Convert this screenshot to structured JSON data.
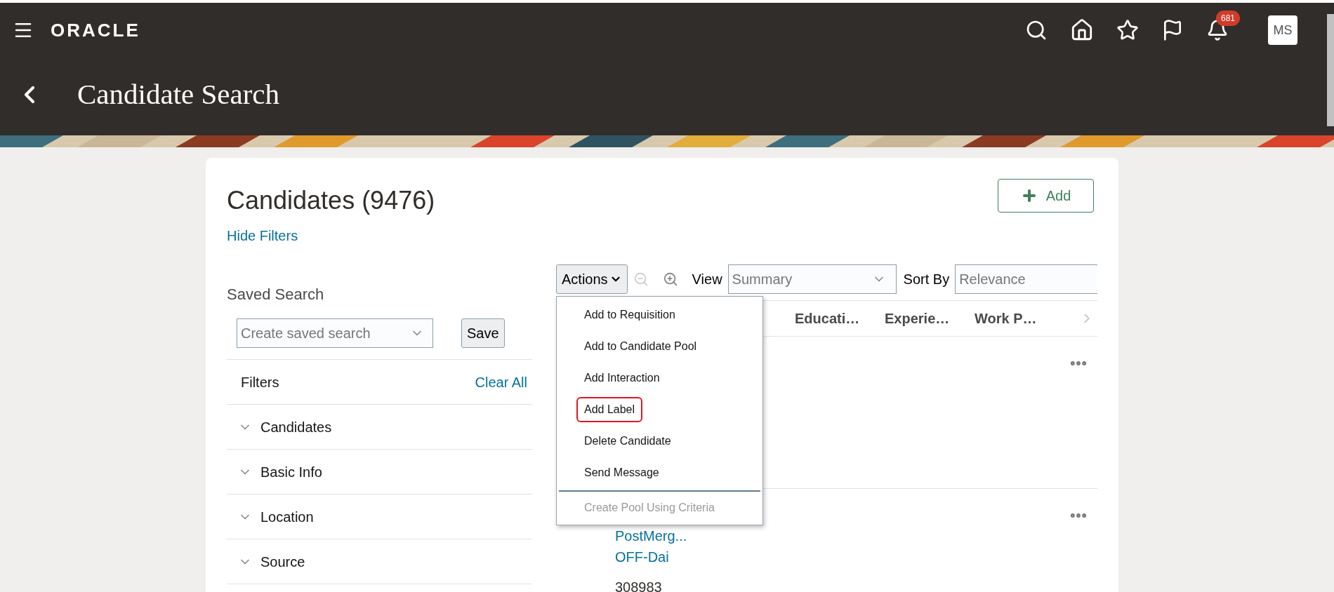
{
  "header": {
    "logo": "ORACLE",
    "notifications": {
      "count": "681"
    },
    "avatar": "MS"
  },
  "page": {
    "title": "Candidate Search"
  },
  "card": {
    "title": "Candidates (9476)",
    "add_button": "Add",
    "hide_filters": "Hide Filters",
    "saved_search": {
      "label": "Saved Search",
      "placeholder": "Create saved search",
      "save_button": "Save"
    },
    "filters": {
      "title": "Filters",
      "clear": "Clear All",
      "sections": [
        {
          "label": "Candidates",
          "expanded": false
        },
        {
          "label": "Basic Info",
          "expanded": false
        },
        {
          "label": "Location",
          "expanded": false
        },
        {
          "label": "Source",
          "expanded": false
        }
      ]
    },
    "toolbar": {
      "actions": "Actions",
      "view_label": "View",
      "view_value": "Summary",
      "sort_label": "Sort By",
      "sort_value": "Relevance"
    },
    "table": {
      "columns": [
        "Educati…",
        "Experie…",
        "Work P…"
      ],
      "rows": [
        {
          "lines": []
        },
        {
          "lines": [
            "PostMerg...",
            "OFF-Dai"
          ],
          "number": "308983"
        }
      ]
    },
    "actions_menu": {
      "items": [
        {
          "label": "Add to Requisition",
          "disabled": false,
          "highlighted": false
        },
        {
          "label": "Add to Candidate Pool",
          "disabled": false,
          "highlighted": false
        },
        {
          "label": "Add Interaction",
          "disabled": false,
          "highlighted": false
        },
        {
          "label": "Add Label",
          "disabled": false,
          "highlighted": true
        },
        {
          "label": "Delete Candidate",
          "disabled": false,
          "highlighted": false
        },
        {
          "label": "Send Message",
          "disabled": false,
          "highlighted": false
        },
        {
          "label": "Create Pool Using Criteria",
          "disabled": true,
          "highlighted": false
        }
      ]
    }
  }
}
